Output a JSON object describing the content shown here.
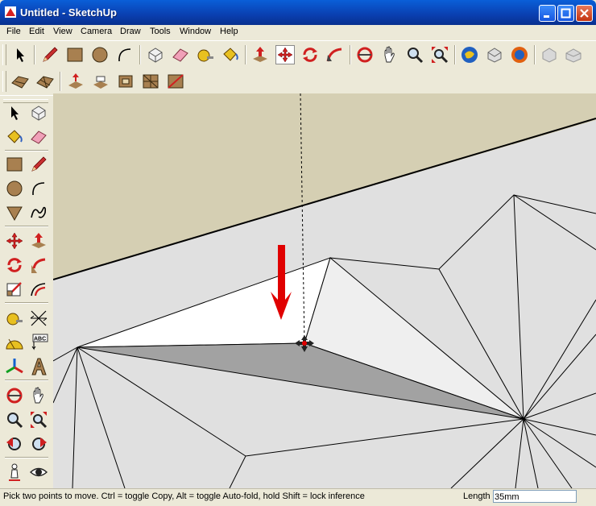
{
  "window": {
    "title": "Untitled - SketchUp"
  },
  "menu": [
    "File",
    "Edit",
    "View",
    "Camera",
    "Draw",
    "Tools",
    "Window",
    "Help"
  ],
  "toolbar_row1": [
    "select-tool",
    "pencil-tool",
    "rectangle-tool",
    "circle-tool",
    "arc-tool",
    "make-component-tool",
    "eraser-tool",
    "tape-measure-tool",
    "paint-bucket-tool",
    "push-pull-tool",
    "move-tool",
    "rotate-tool",
    "follow-me-tool",
    "orbit-tool",
    "pan-tool",
    "zoom-tool",
    "zoom-extents-tool",
    "get-models-tool",
    "share-model-tool",
    "share-component-tool",
    "add-location-tool",
    "toggle-terrain-tool"
  ],
  "toolbar_row2": [
    "sandbox-from-contours-tool",
    "sandbox-from-scratch-tool",
    "smoove-tool",
    "stamp-tool",
    "drape-tool",
    "add-detail-tool",
    "flip-edge-tool"
  ],
  "side_tools": [
    "select-tool",
    "make-component-tool",
    "paint-bucket-tool",
    "eraser-tool",
    "rectangle-tool",
    "pencil-tool",
    "circle-tool",
    "arc-tool",
    "polygon-tool",
    "freehand-tool",
    "move-tool",
    "push-pull-tool",
    "rotate-tool",
    "follow-me-tool",
    "scale-tool",
    "offset-tool",
    "tape-measure-tool",
    "dimension-tool",
    "protractor-tool",
    "text-tool",
    "axes-tool",
    "3d-text-tool",
    "orbit-tool",
    "pan-tool",
    "zoom-tool",
    "zoom-window-tool",
    "previous-view-tool",
    "next-view-tool",
    "position-camera-tool",
    "look-around-tool"
  ],
  "side_text": {
    "abc_label": "ABC"
  },
  "status": {
    "hint": "Pick two points to move.  Ctrl = toggle Copy, Alt = toggle Auto-fold, hold Shift = lock inference",
    "length_label": "Length",
    "length_value": "35mm"
  },
  "colors": {
    "title_bar": "#0a3fb0",
    "chrome": "#ece9d8",
    "sky": "#d5cfb3",
    "ground": "#e0e0e0",
    "arrow": "#e00000",
    "shade": "#a2a2a2"
  }
}
